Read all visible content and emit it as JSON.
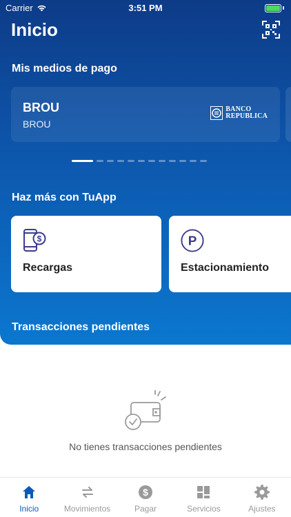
{
  "status_bar": {
    "carrier": "Carrier",
    "time": "3:51 PM"
  },
  "header": {
    "title": "Inicio"
  },
  "payment_methods": {
    "heading": "Mis medios de pago",
    "card": {
      "name": "BROU",
      "subtitle": "BROU",
      "logo_line1": "BANCO",
      "logo_line2": "REPUBLICA"
    },
    "page_count": 12,
    "active_page": 1
  },
  "more": {
    "heading": "Haz más con TuApp",
    "tiles": [
      {
        "label": "Recargas",
        "icon": "phone-dollar-icon"
      },
      {
        "label": "Estacionamiento",
        "icon": "parking-icon"
      }
    ]
  },
  "pending": {
    "heading": "Transacciones pendientes",
    "empty_message": "No tienes transacciones pendientes"
  },
  "tabbar": {
    "items": [
      {
        "label": "Inicio",
        "icon": "home-icon",
        "active": true
      },
      {
        "label": "Movimientos",
        "icon": "transfer-arrows-icon",
        "active": false
      },
      {
        "label": "Pagar",
        "icon": "dollar-icon",
        "active": false
      },
      {
        "label": "Servicios",
        "icon": "grid-icon",
        "active": false
      },
      {
        "label": "Ajustes",
        "icon": "gear-icon",
        "active": false
      }
    ]
  },
  "colors": {
    "primary_dark": "#0d3b87",
    "primary_light": "#0b77cf",
    "active_tab": "#0a5bb5",
    "accent_purple": "#3b3a8f"
  }
}
